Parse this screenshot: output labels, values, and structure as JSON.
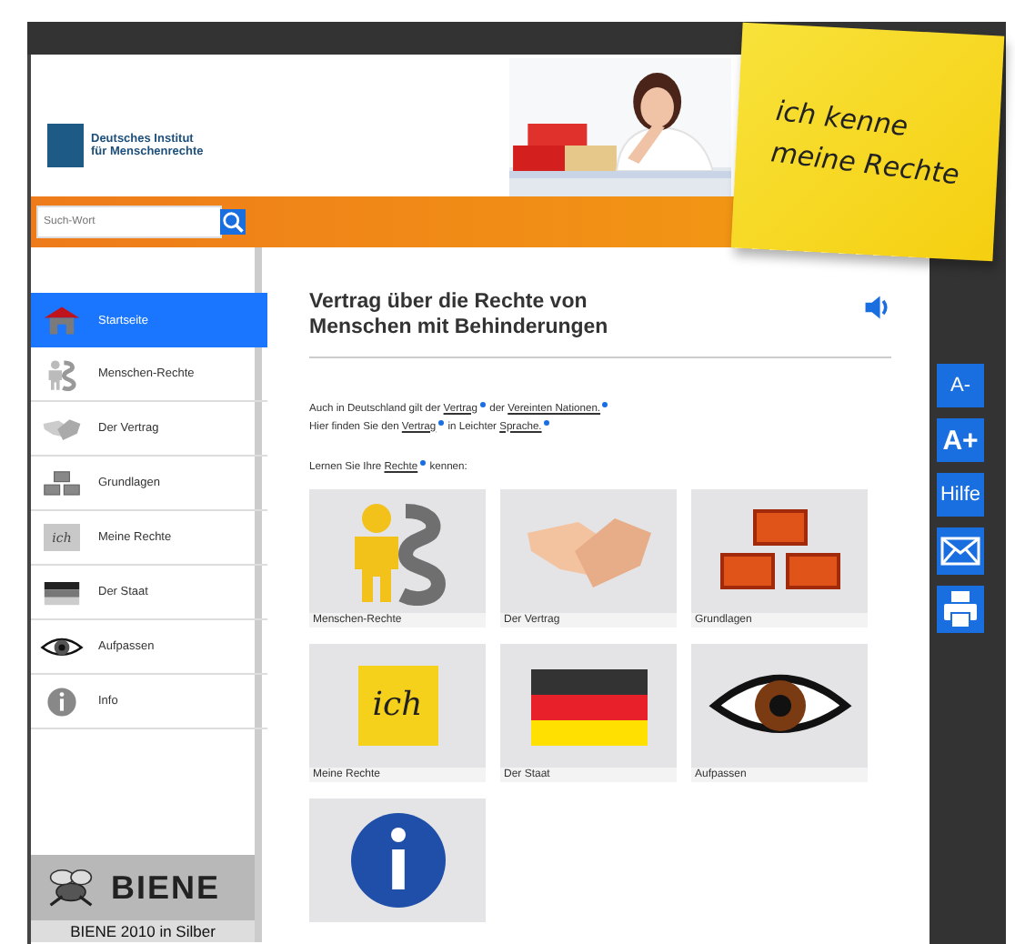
{
  "logo": {
    "line1": "Deutsches Institut",
    "line2": "für Menschenrechte"
  },
  "note": {
    "line1": "ich kenne",
    "line2": "meine Rechte"
  },
  "search": {
    "placeholder": "Such-Wort"
  },
  "sidebar": {
    "items": [
      {
        "label": "Startseite",
        "kind": "home",
        "selected": true
      },
      {
        "label": "Menschen-Rechte",
        "kind": "person",
        "selected": false
      },
      {
        "label": "Der Vertrag",
        "kind": "handshake",
        "selected": false
      },
      {
        "label": "Grundlagen",
        "kind": "bricks",
        "selected": false
      },
      {
        "label": "Meine Rechte",
        "kind": "note",
        "icon_text": "ich",
        "selected": false
      },
      {
        "label": "Der Staat",
        "kind": "flag",
        "selected": false
      },
      {
        "label": "Aufpassen",
        "kind": "eye",
        "selected": false
      },
      {
        "label": "Info",
        "kind": "info",
        "selected": false
      }
    ]
  },
  "award": {
    "logo_text": "BIENE",
    "caption": "BIENE 2010 in Silber"
  },
  "title": "Vertrag über die Rechte von Menschen mit Behinderungen",
  "paragraphs": [
    [
      {
        "text": "Auch in Deutschland gilt der "
      },
      {
        "link": "Vertrag"
      },
      {
        "text": " der "
      },
      {
        "link": "Vereinten Nationen."
      }
    ],
    [
      {
        "text": "Hier finden Sie den "
      },
      {
        "link": "Vertrag"
      },
      {
        "text": " in Leichter "
      },
      {
        "link": "Sprache."
      }
    ],
    [
      {
        "text": "Lernen Sie Ihre "
      },
      {
        "link": "Rechte"
      },
      {
        "text": " kennen:"
      }
    ]
  ],
  "tiles": [
    {
      "label": "Menschen-Rechte",
      "kind": "person"
    },
    {
      "label": "Der Vertrag",
      "kind": "handshake"
    },
    {
      "label": "Grundlagen",
      "kind": "bricks"
    },
    {
      "label": "Meine Rechte",
      "kind": "note",
      "icon_text": "ich"
    },
    {
      "label": "Der Staat",
      "kind": "flag"
    },
    {
      "label": "Aufpassen",
      "kind": "eye"
    },
    {
      "kind": "info"
    }
  ],
  "tools": [
    {
      "label": "A-",
      "kind": "text"
    },
    {
      "label": "A+",
      "kind": "big"
    },
    {
      "label": "Hilfe",
      "kind": "text"
    },
    {
      "kind": "mail"
    },
    {
      "kind": "print"
    }
  ]
}
